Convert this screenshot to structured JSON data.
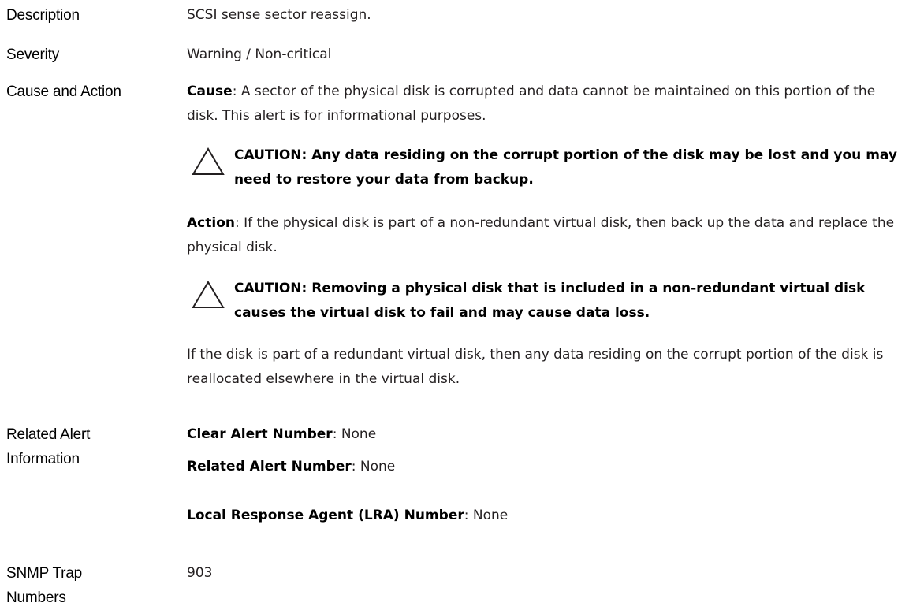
{
  "description": {
    "label": "Description",
    "value": "SCSI sense sector reassign."
  },
  "severity": {
    "label": "Severity",
    "value": "Warning / Non-critical"
  },
  "cause_action": {
    "label": "Cause and Action",
    "cause_kw": "Cause",
    "cause_text": ": A sector of the physical disk is corrupted and data cannot be maintained on this portion of the disk. This alert is for informational purposes.",
    "caution1": "CAUTION: Any data residing on the corrupt portion of the disk may be lost and you may need to restore your data from backup.",
    "action_kw": "Action",
    "action_text": ": If the physical disk is part of a non-redundant virtual disk, then back up the data and replace the physical disk.",
    "caution2": "CAUTION: Removing a physical disk that is included in a non-redundant virtual disk causes the virtual disk to fail and may cause data loss.",
    "redundant_text": "If the disk is part of a redundant virtual disk, then any data residing on the corrupt portion of the disk is reallocated elsewhere in the virtual disk."
  },
  "related": {
    "label": "Related Alert Information",
    "clear_kw": "Clear Alert Number",
    "clear_val": ": None",
    "related_kw": "Related Alert Number",
    "related_val": ": None",
    "lra_kw": "Local Response Agent (LRA) Number",
    "lra_val": ": None"
  },
  "snmp": {
    "label": "SNMP Trap Numbers",
    "value": "903"
  },
  "icons": {
    "caution": "caution-triangle-icon"
  }
}
